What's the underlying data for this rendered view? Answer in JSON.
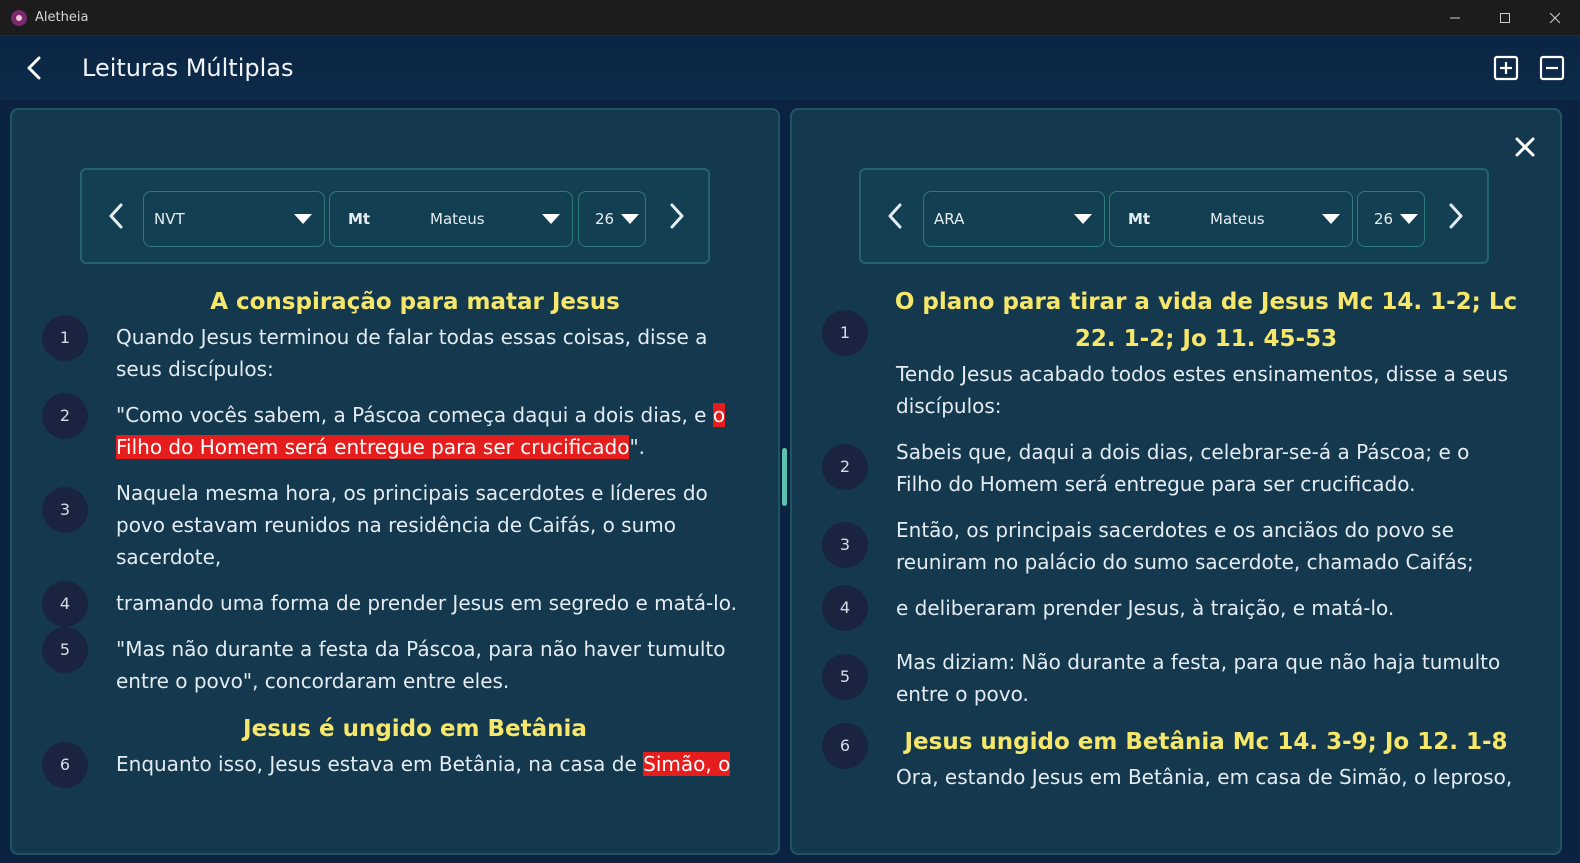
{
  "window": {
    "title": "Aletheia"
  },
  "appbar": {
    "title": "Leituras Múltiplas"
  },
  "left": {
    "version": "NVT",
    "book_abbr": "Mt",
    "book": "Mateus",
    "chapter": "26",
    "heading1": "A conspiração para matar Jesus",
    "verses": [
      {
        "n": "1",
        "text": "Quando Jesus terminou de falar todas essas coisas, disse a seus discípulos:"
      },
      {
        "n": "2",
        "pre": "\"Como vocês sabem, a Páscoa começa daqui a dois dias, e ",
        "hl": "o Filho do Homem será entregue para ser crucificado",
        "post": "\"."
      },
      {
        "n": "3",
        "text": "Naquela mesma hora, os principais sacerdotes e líderes do povo estavam reunidos na residência de Caifás, o sumo sacerdote,"
      },
      {
        "n": "4",
        "text": "tramando uma forma de prender Jesus em segredo e matá-lo."
      },
      {
        "n": "5",
        "text": "\"Mas não durante a festa da Páscoa, para não haver tumulto entre o povo\", concordaram entre eles."
      }
    ],
    "heading2": "Jesus é ungido em Betânia",
    "verse6": {
      "n": "6",
      "pre": "Enquanto isso, Jesus estava em Betânia, na casa de ",
      "hl": "Simão, o"
    }
  },
  "right": {
    "version": "ARA",
    "book_abbr": "Mt",
    "book": "Mateus",
    "chapter": "26",
    "heading1": "O plano para tirar a vida de Jesus  Mc 14. 1-2; Lc 22. 1-2; Jo 11. 45-53",
    "verses": [
      {
        "n": "1",
        "text": "Tendo Jesus acabado todos estes ensinamentos, disse a seus discípulos:"
      },
      {
        "n": "2",
        "text": "Sabeis que, daqui a dois dias, celebrar-se-á a Páscoa; e o Filho do Homem será entregue para ser crucificado."
      },
      {
        "n": "3",
        "text": "Então, os principais sacerdotes e os anciãos do povo se reuniram no palácio do sumo sacerdote, chamado Caifás;"
      },
      {
        "n": "4",
        "text": "e deliberaram prender Jesus, à traição, e matá-lo."
      },
      {
        "n": "5",
        "text": "Mas diziam: Não durante a festa, para que não haja tumulto entre o povo."
      }
    ],
    "heading2": "Jesus ungido em Betânia  Mc 14. 3-9; Jo 12. 1-8",
    "verse6": {
      "n": "6",
      "text": "Ora, estando Jesus em Betânia, em casa de Simão, o leproso,"
    }
  },
  "colors": {
    "accent_heading": "#f6e76a",
    "highlight": "#e51d1d",
    "panel": "#14394f"
  }
}
